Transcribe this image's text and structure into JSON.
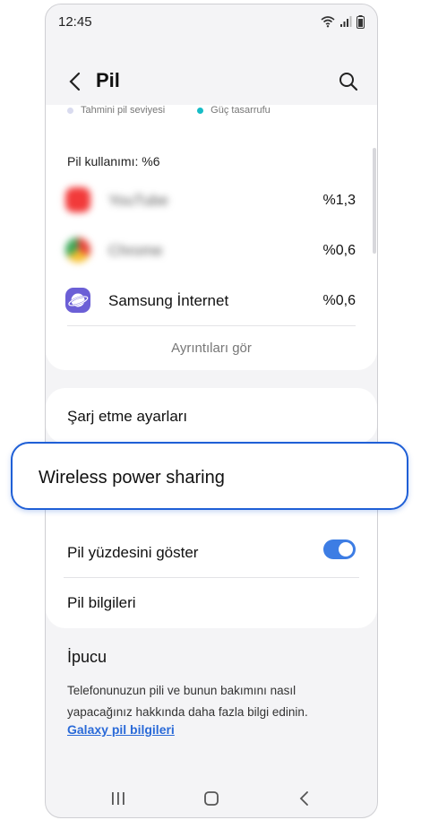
{
  "status_bar": {
    "time": "12:45"
  },
  "app_bar": {
    "title": "Pil"
  },
  "legend": {
    "items": [
      {
        "label": "Tahmini pil seviyesi",
        "color": "#d9dbef"
      },
      {
        "label": "Güç tasarrufu",
        "color": "#17bcc6"
      }
    ]
  },
  "usage": {
    "label": "Pil kullanımı: %6",
    "apps": [
      {
        "name": "YouTube",
        "percent": "%1,3",
        "icon": "youtube-icon",
        "color": "#f23a3a"
      },
      {
        "name": "Chrome",
        "percent": "%0,6",
        "icon": "chrome-icon",
        "color": "#e8a13a"
      },
      {
        "name": "Samsung İnternet",
        "percent": "%0,6",
        "icon": "samsung-internet-icon",
        "color": "#6b5fd6"
      }
    ],
    "details_label": "Ayrıntıları gör"
  },
  "settings": {
    "charging_label": "Şarj etme ayarları",
    "wireless_label": "Wireless power sharing",
    "show_percentage_label": "Pil yüzdesini göster",
    "show_percentage_on": true,
    "battery_info_label": "Pil bilgileri"
  },
  "tip": {
    "title": "İpucu",
    "body": "Telefonunuzun pili ve bunun bakımını nasıl yapacağınız hakkında daha fazla bilgi edinin.",
    "link": "Galaxy pil bilgileri"
  },
  "colors": {
    "accent": "#1f5fd6",
    "toggle": "#3d7de4",
    "link": "#2a6ad8",
    "background": "#f4f4f6"
  }
}
